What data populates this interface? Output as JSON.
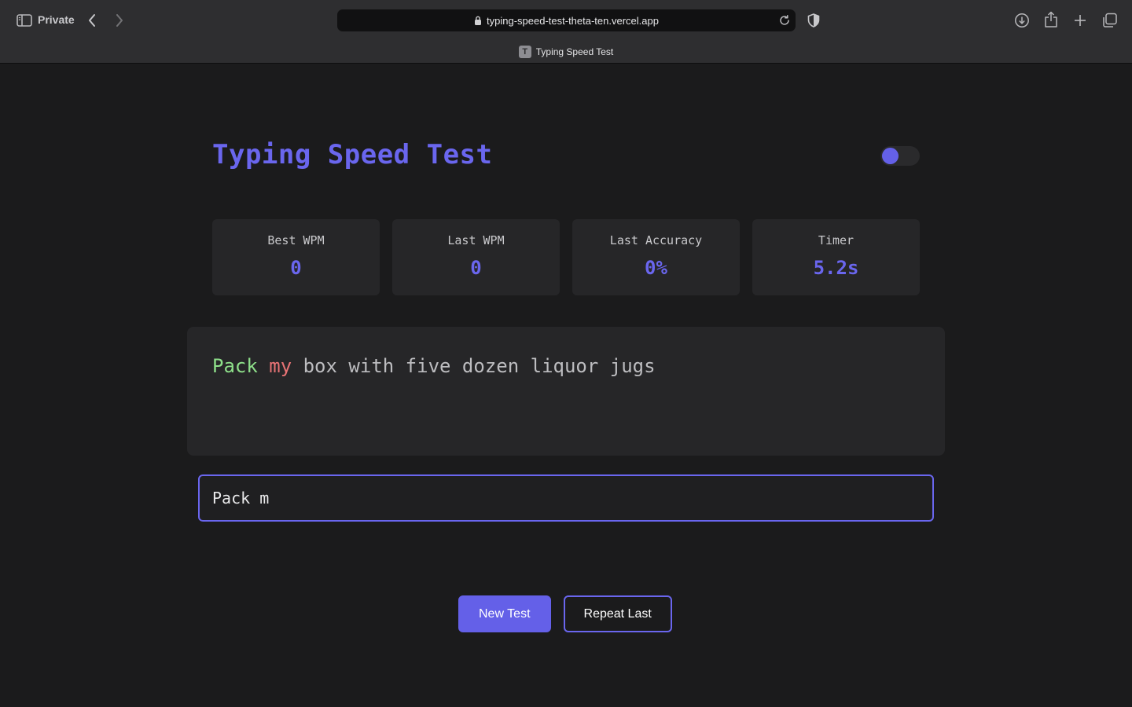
{
  "browser": {
    "private_label": "Private",
    "url": "typing-speed-test-theta-ten.vercel.app",
    "tab_title": "Typing Speed Test",
    "tab_favicon_letter": "T"
  },
  "app": {
    "title": "Typing Speed Test",
    "theme_toggle_on": false,
    "stats": [
      {
        "label": "Best WPM",
        "value": "0"
      },
      {
        "label": "Last WPM",
        "value": "0"
      },
      {
        "label": "Last Accuracy",
        "value": "0%"
      },
      {
        "label": "Timer",
        "value": "5.2s"
      }
    ],
    "prompt": {
      "words": [
        {
          "text": "Pack",
          "state": "correct"
        },
        {
          "text": "my",
          "state": "wrong"
        },
        {
          "text": "box",
          "state": "pending"
        },
        {
          "text": "with",
          "state": "pending"
        },
        {
          "text": "five",
          "state": "pending"
        },
        {
          "text": "dozen",
          "state": "pending"
        },
        {
          "text": "liquor",
          "state": "pending"
        },
        {
          "text": "jugs",
          "state": "pending"
        }
      ]
    },
    "input_value": "Pack m",
    "buttons": {
      "new_test": "New Test",
      "repeat_last": "Repeat Last"
    }
  },
  "colors": {
    "accent": "#6a66ee",
    "correct": "#8ee08a",
    "wrong": "#e87375"
  }
}
